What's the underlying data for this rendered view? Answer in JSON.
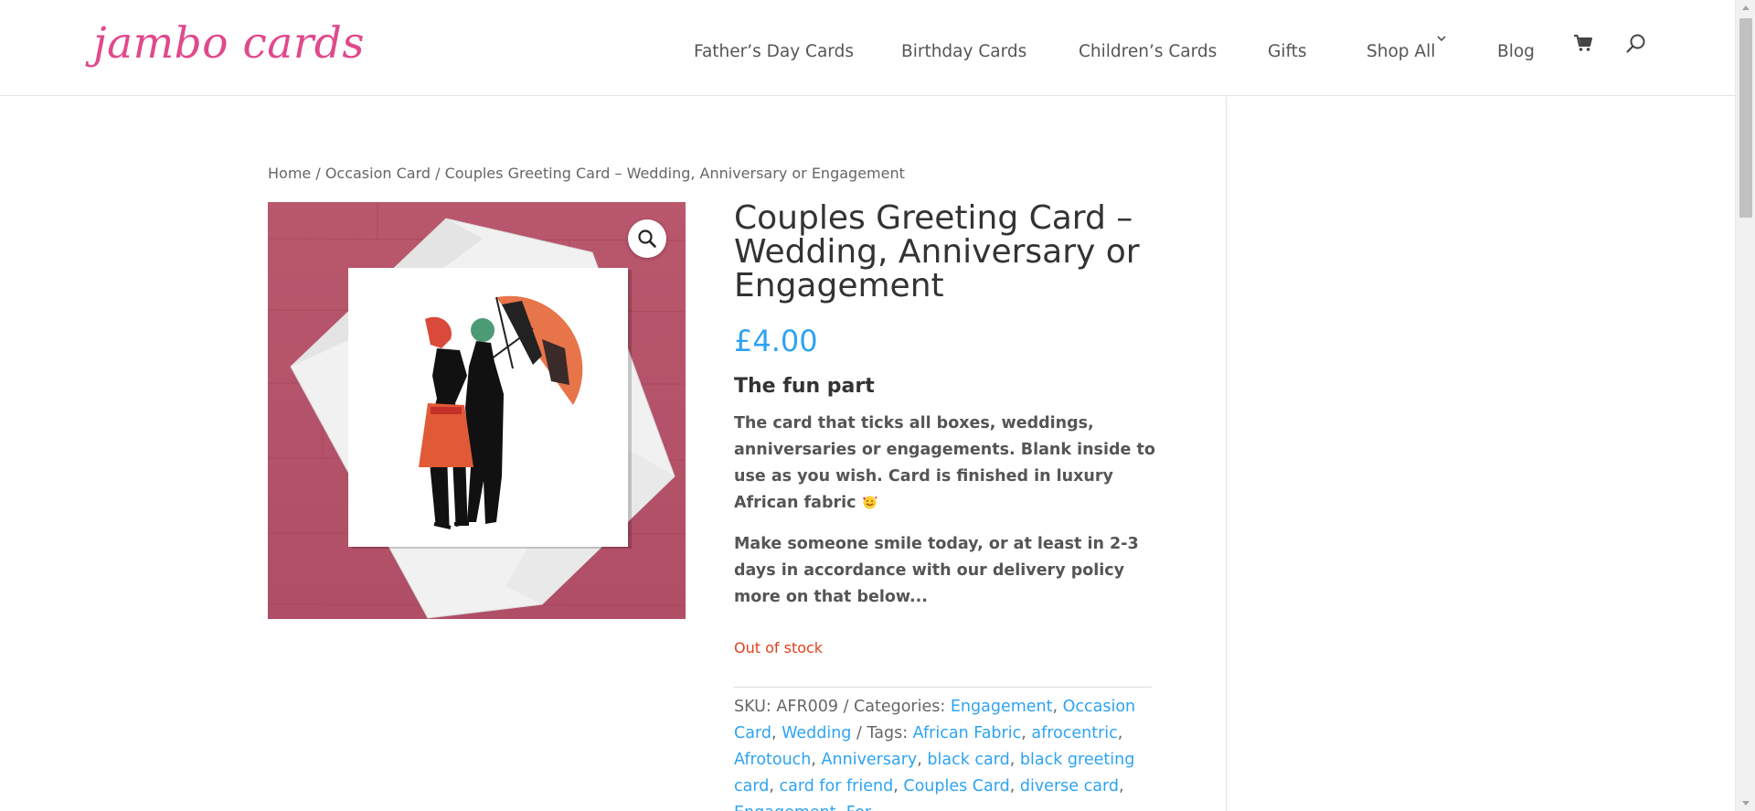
{
  "header": {
    "logo": "jambo cards",
    "nav": [
      {
        "label": "Father’s Day Cards"
      },
      {
        "label": "Birthday Cards"
      },
      {
        "label": "Children’s Cards"
      },
      {
        "label": "Gifts"
      },
      {
        "label": "Shop All"
      },
      {
        "label": "Blog"
      }
    ],
    "icons": [
      "chevron-down-icon",
      "cart-icon",
      "search-icon"
    ]
  },
  "breadcrumb": {
    "home": "Home",
    "sep1": " / ",
    "category": "Occasion Card",
    "sep2": " / ",
    "current": "Couples Greeting Card – Wedding, Anniversary or Engagement"
  },
  "product": {
    "title": "Couples Greeting Card – Wedding, Anniversary or Engagement",
    "price": "£4.00",
    "subheading": "The fun part",
    "description_1": "The card that ticks all boxes, weddings, anniversaries or engagements. Blank inside to use as you wish. Card is finished in luxury African fabric",
    "description_2": "Make someone smile today, or at least in 2-3 days in accordance with our delivery policy more on that below...",
    "stock_status": "Out of stock",
    "zoom_icon": "magnifier-icon",
    "meta": {
      "sku_label": "SKU:",
      "sku": "AFR009",
      "categories_label": "Categories:",
      "categories": [
        "Engagement",
        "Occasion Card",
        "Wedding"
      ],
      "tags_label": "Tags:",
      "tags": [
        "African Fabric",
        "afrocentric",
        "Afrotouch",
        "Anniversary",
        "black card",
        "black greeting card",
        "card for friend",
        "Couples Card",
        "diverse card",
        "Engagement",
        "For"
      ]
    }
  },
  "colors": {
    "logo": "#e0498c",
    "link": "#2ea3f2",
    "out_of_stock": "#e2401c",
    "image_bg": "#b55268"
  }
}
